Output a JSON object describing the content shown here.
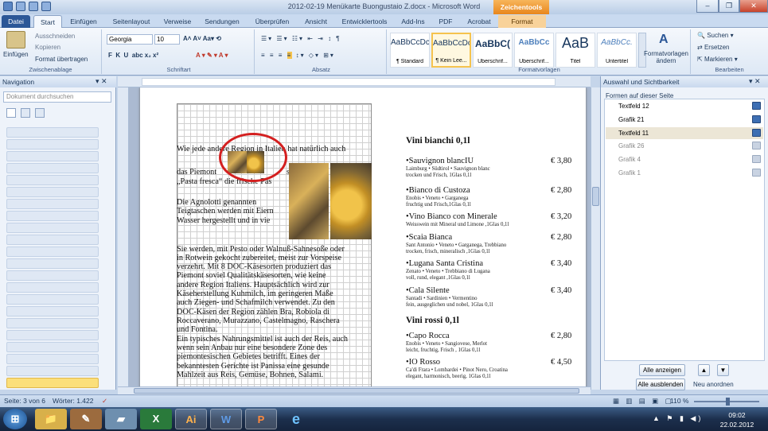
{
  "window": {
    "title": "2012-02-19 Menükarte Buongustaio Z.docx - Microsoft Word",
    "context_tab": "Zeichentools",
    "minimize": "–",
    "restore": "❐",
    "close": "✕"
  },
  "tabs": [
    {
      "label": "Datei"
    },
    {
      "label": "Start"
    },
    {
      "label": "Einfügen"
    },
    {
      "label": "Seitenlayout"
    },
    {
      "label": "Verweise"
    },
    {
      "label": "Sendungen"
    },
    {
      "label": "Überprüfen"
    },
    {
      "label": "Ansicht"
    },
    {
      "label": "Entwicklertools"
    },
    {
      "label": "Add-Ins"
    },
    {
      "label": "PDF"
    },
    {
      "label": "Acrobat"
    },
    {
      "label": "Format"
    }
  ],
  "ribbon": {
    "clipboard": {
      "paste": "Einfügen",
      "cut": "Ausschneiden",
      "copy": "Kopieren",
      "format_painter": "Format übertragen",
      "group": "Zwischenablage"
    },
    "font": {
      "name": "Georgia",
      "size": "10",
      "group": "Schriftart"
    },
    "paragraph": {
      "group": "Absatz"
    },
    "styles": {
      "items": [
        {
          "sample": "AaBbCcDc",
          "name": "¶ Standard"
        },
        {
          "sample": "AaBbCcDc",
          "name": "¶ Kein Lee..."
        },
        {
          "sample": "AaBbC(",
          "name": "Überschrif..."
        },
        {
          "sample": "AaBbCc",
          "name": "Überschrif..."
        },
        {
          "sample": "AaB",
          "name": "Titel"
        },
        {
          "sample": "AaBbCc.",
          "name": "Untertitel"
        }
      ],
      "change": "Formatvorlagen ändern",
      "group": "Formatvorlagen"
    },
    "editing": {
      "find": "Suchen",
      "replace": "Ersetzen",
      "select": "Markieren",
      "group": "Bearbeiten"
    }
  },
  "navigation": {
    "title": "Navigation",
    "search_placeholder": "Dokument durchsuchen",
    "slot_count": 22
  },
  "document": {
    "left_paragraphs": [
      "Wie jede andere Region in Italien hat natürlich auch",
      "das Piemont",
      "seine e",
      "„Pasta fresca“ die frische Pas",
      "Die   Agnolotti   genannten",
      "Teigtaschen werden mit Eiern",
      "Wasser hergestellt und in vie",
      "Sie werden, mit Pesto oder Walnuß-Sahnesoße oder",
      "in Rotwein gekocht zubereitet, meist zur Vorspeise",
      "verzehrt.  Mit  8  DOC-Käsesorten  produziert  das",
      "Piemont   soviel   Qualitätskäsesorten,   wie   keine",
      "andere   Region   Italiens.   Hauptsächlich   wird   zur",
      "Käseherstellung  Kuhmilch,  im  geringeren  Maße",
      "auch  Ziegen-  und  Schafmilch  verwendet.  Zu  den",
      "DOC-Käsen  der  Region  zählen  Bra,  Robiola  di",
      "Roccaverano, Murazzano, Castelmagno, Raschera",
      "und Fontina.",
      "Ein typisches Nahrungsmittel ist auch der Reis, auch",
      "wenn  sein  Anbau  nur  eine  besondere  Zone  des",
      "piemontesischen    Gebietes    betrifft.    Eines    der",
      "bekanntesten  Gerichte  ist  Panissa  eine  gesunde",
      "Mahlzeit  aus  Reis,  Gemüse,  Bohnen,  Salami."
    ],
    "menu": {
      "white_header": "Vini bianchi 0,1l",
      "red_header": "Vini rossi 0,1l",
      "white": [
        {
          "name": "•Sauvignon blancIU",
          "desc1": "Laimburg • Südtirol • Sauvignon blanc",
          "desc2": "trocken und Frisch, 1Glas 0,1l",
          "price": "€ 3,80"
        },
        {
          "name": "•Bianco di Custoza",
          "desc1": "Enobis • Veneto • Garganega",
          "desc2": "fruchtig und Frisch,1Glas 0,1l",
          "price": "€ 2,80"
        },
        {
          "name": "•Vino Bianco con Minerale",
          "desc1": "Weisswein mit Mineral und Limone ,1Glas 0,1l",
          "desc2": "",
          "price": "€ 3,20"
        },
        {
          "name": "•Scaia Bianca",
          "desc1": "Sant Antonio • Veneto • Garganega, Trebbiano",
          "desc2": "trocken, frisch, mineralisch ,1Glas 0,1l",
          "price": "€ 2,80"
        },
        {
          "name": "•Lugana Santa Cristina",
          "desc1": "Zenato • Veneto • Trebbiano di Lugana",
          "desc2": "voll, rund, elegant ,1Glas 0,1l",
          "price": "€ 3,40"
        },
        {
          "name": "•Cala Silente",
          "desc1": "Santadi • Sardinien • Vermentino",
          "desc2": "fein, ausgeglichen und nobel, 1Glas 0,1l",
          "price": "€ 3,40"
        }
      ],
      "red": [
        {
          "name": "•Capo Rocca",
          "desc1": "Enobis • Veneto • Sangiovese, Merlot",
          "desc2": "leicht, fruchtig, Frisch , 1Glas 0,1l",
          "price": "€ 2,80"
        },
        {
          "name": "•IO Rosso",
          "desc1": "Ca'di Frara • Lombardei • Pinot Nero, Croatina",
          "desc2": "elegant, harmonisch, beerig, 1Glas 0,1l",
          "price": "€ 4,50"
        }
      ]
    }
  },
  "selection_pane": {
    "title": "Auswahl und Sichtbarkeit",
    "subtitle": "Formen auf dieser Seite",
    "items": [
      {
        "label": "Textfeld 12",
        "state": "visible"
      },
      {
        "label": "Grafik 21",
        "state": "visible"
      },
      {
        "label": "Textfeld 11",
        "state": "selected"
      },
      {
        "label": "Grafik 26",
        "state": "dim"
      },
      {
        "label": "Grafik 4",
        "state": "dim"
      },
      {
        "label": "Grafik 1",
        "state": "dim"
      }
    ],
    "show_all": "Alle anzeigen",
    "hide_all": "Alle ausblenden",
    "reorder": "Neu anordnen"
  },
  "status": {
    "page": "Seite: 3 von 6",
    "words": "Wörter: 1.422",
    "zoom": "110 %"
  },
  "taskbar": {
    "time": "09:02",
    "date": "22.02.2012",
    "apps": [
      {
        "label": "⊞"
      },
      {
        "label": "📁"
      },
      {
        "label": "✎"
      },
      {
        "label": "▰"
      },
      {
        "label": "X"
      },
      {
        "label": "Ai"
      },
      {
        "label": "W"
      },
      {
        "label": "P"
      },
      {
        "label": "e"
      }
    ]
  },
  "colors": {
    "accent": "#2b5797",
    "context": "#e8861c",
    "selection_circle": "#d42020"
  }
}
